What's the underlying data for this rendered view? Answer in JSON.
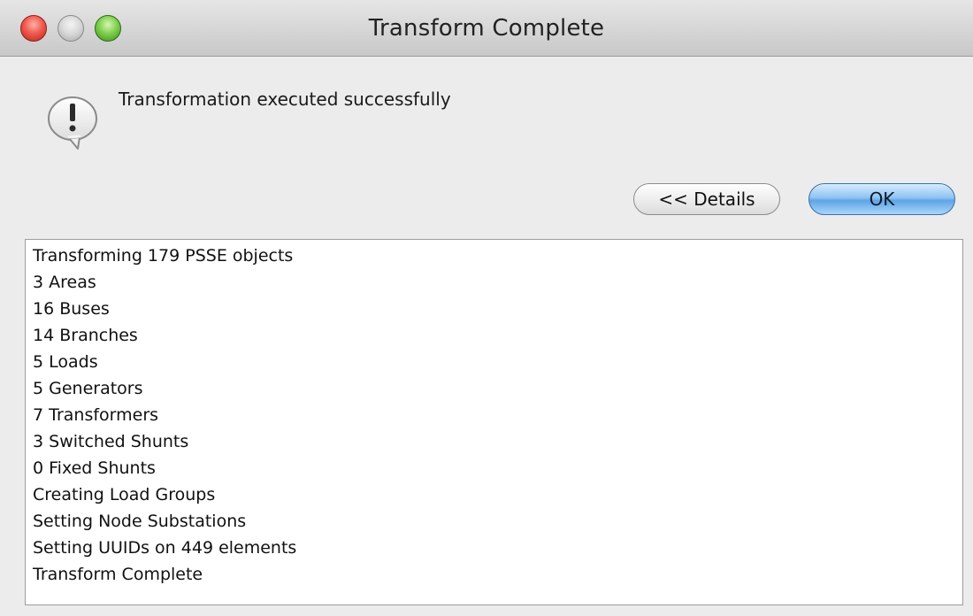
{
  "window": {
    "title": "Transform Complete"
  },
  "dialog": {
    "message": "Transformation executed successfully",
    "details_button": "<< Details",
    "ok_button": "OK"
  },
  "details": {
    "lines": [
      "Transforming 179 PSSE objects",
      "3 Areas",
      "16 Buses",
      "14 Branches",
      "5 Loads",
      "5 Generators",
      "7 Transformers",
      "3 Switched Shunts",
      "0 Fixed Shunts",
      "Creating Load Groups",
      "Setting Node Substations",
      "Setting UUIDs on 449 elements",
      "Transform Complete"
    ]
  },
  "icons": {
    "close": "close-icon",
    "minimize": "minimize-icon",
    "zoom": "zoom-icon",
    "alert": "exclamation-speech-bubble-icon"
  },
  "colors": {
    "ok_button": "#8fc3f1",
    "close_button": "#f05a4f",
    "zoom_button": "#7fd04e"
  }
}
